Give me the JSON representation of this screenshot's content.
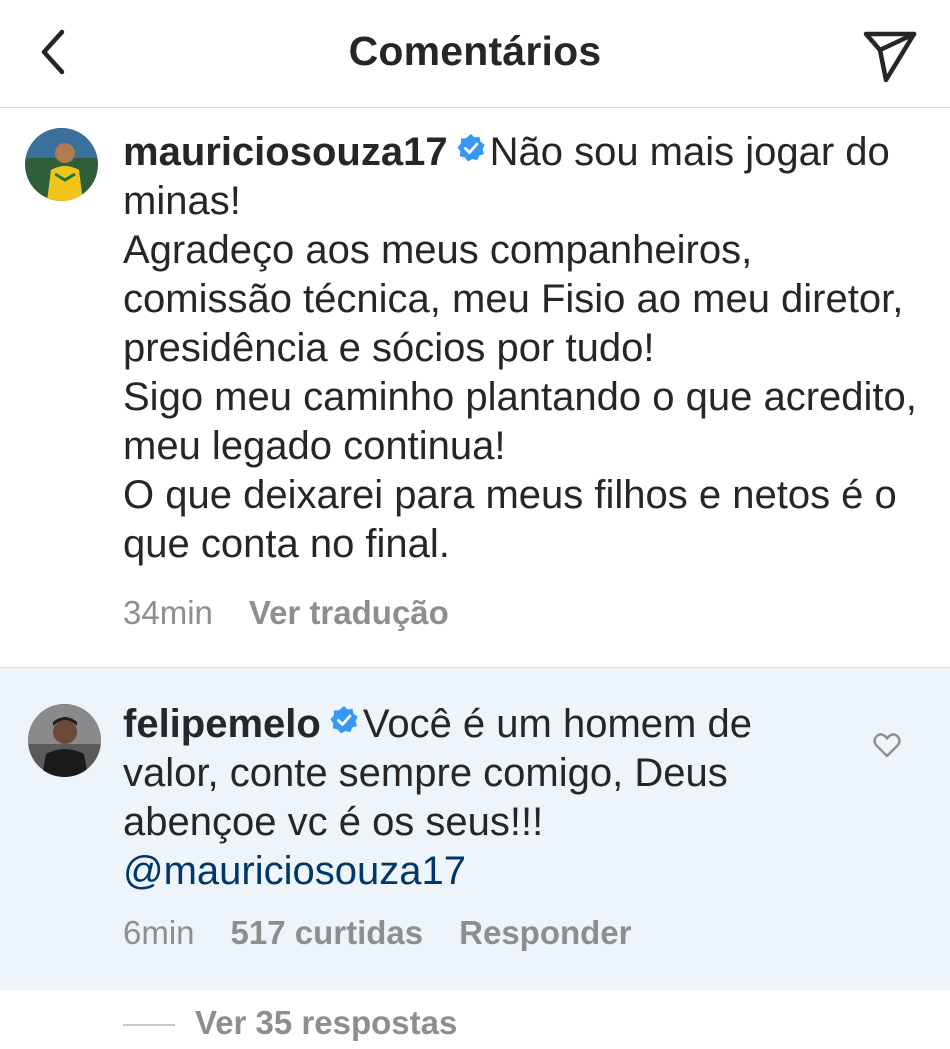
{
  "header": {
    "title": "Comentários",
    "back_icon": "chevron-left-icon",
    "share_icon": "paper-plane-icon"
  },
  "caption": {
    "username": "mauriciosouza17",
    "verified": true,
    "paragraphs": [
      "Não sou mais jogar do minas!",
      "Agradeço aos meus companheiros, comissão técnica, meu Fisio ao meu diretor, presidência e sócios por tudo!",
      "Sigo meu caminho plantando o que acredito, meu legado continua!",
      "O que deixarei para meus filhos e netos é o que conta no final."
    ],
    "time": "34min",
    "translate_label": "Ver tradução"
  },
  "comment": {
    "username": "felipemelo",
    "verified": true,
    "text": "Você é um homem de valor, conte sempre comigo, Deus abençoe vc é os seus!!!",
    "mention": "@mauriciosouza17",
    "time": "6min",
    "likes": "517 curtidas",
    "reply_label": "Responder",
    "like_icon": "heart-outline-icon",
    "highlight_color": "#edf5fa"
  },
  "replies": {
    "label": "Ver 35 respostas"
  },
  "colors": {
    "text": "#262626",
    "secondary": "#8e8e8e",
    "verified": "#3897f0",
    "mention": "#00376b"
  }
}
